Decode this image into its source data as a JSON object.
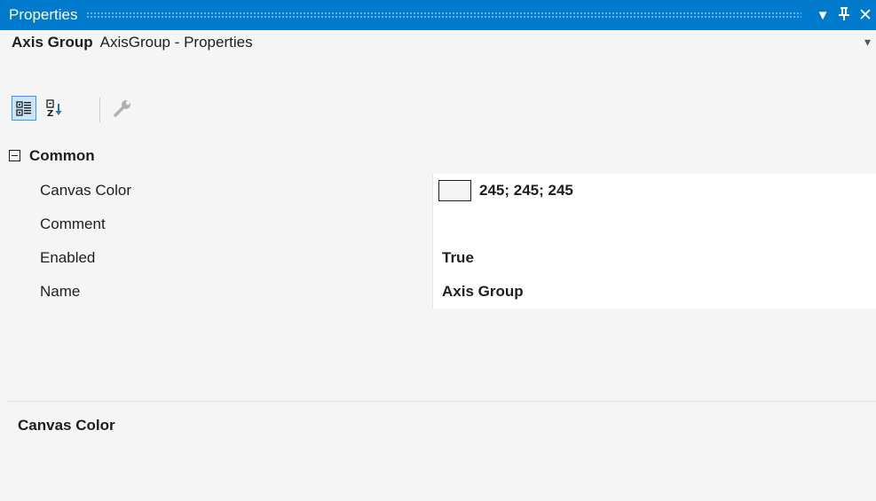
{
  "titlebar": {
    "title": "Properties",
    "icons": [
      "chevron-down-icon",
      "pin-icon",
      "close-icon"
    ]
  },
  "object_selector": {
    "name": "Axis Group",
    "type": "AxisGroup - Properties"
  },
  "toolbar": {
    "buttons": [
      "categorized-icon",
      "alphabetical-icon",
      "property-pages-icon"
    ]
  },
  "grid": {
    "category": "Common",
    "rows": [
      {
        "name": "Canvas Color",
        "value": "245; 245; 245",
        "swatch": "#f5f5f5"
      },
      {
        "name": "Comment",
        "value": ""
      },
      {
        "name": "Enabled",
        "value": "True"
      },
      {
        "name": "Name",
        "value": "Axis Group"
      }
    ]
  },
  "description": {
    "title": "Canvas Color"
  },
  "colors": {
    "accent": "#007acc",
    "background": "#f5f5f5"
  }
}
